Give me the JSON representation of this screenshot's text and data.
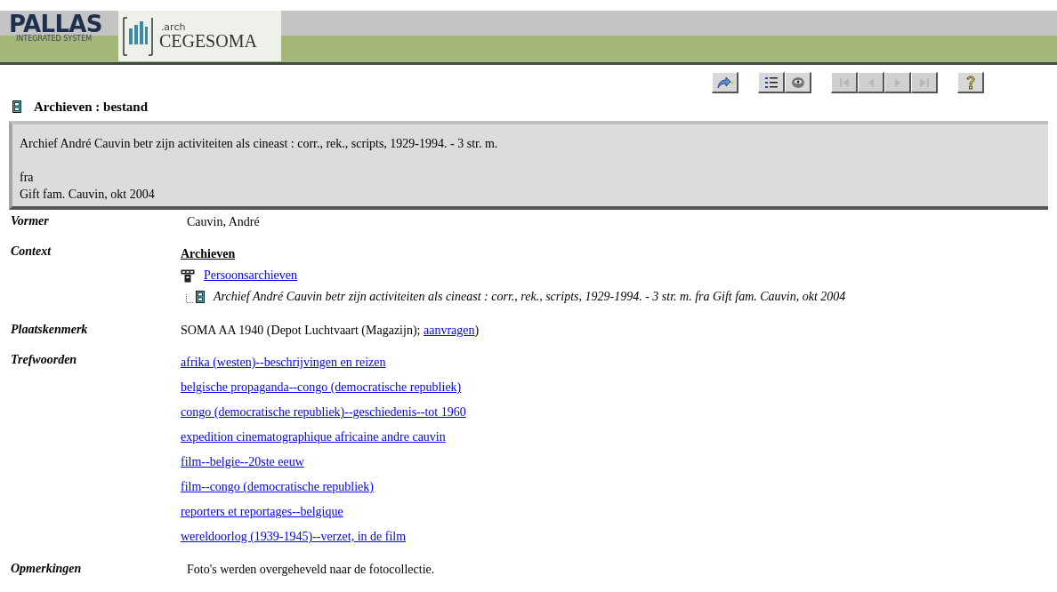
{
  "header": {
    "pallas_logo": {
      "title": "PALLAS",
      "subtitle": "INTEGRATED SYSTEM"
    },
    "cegesoma_logo": {
      "prefix": ".arch",
      "title": "CEGESOMA"
    }
  },
  "toolbar": [
    {
      "kind": "forward",
      "disabled": false
    },
    {
      "kind": "list",
      "disabled": false
    },
    {
      "kind": "view",
      "disabled": false
    },
    {
      "kind": "first",
      "disabled": true
    },
    {
      "kind": "prev",
      "disabled": true
    },
    {
      "kind": "next",
      "disabled": true
    },
    {
      "kind": "last",
      "disabled": true
    },
    {
      "kind": "help",
      "disabled": false
    }
  ],
  "page_title": "Archieven : bestand",
  "summary": {
    "description": "Archief André Cauvin betr zijn activiteiten als cineast : corr., rek., scripts, 1929-1994. - 3 str. m.",
    "language": "fra",
    "acquisition": "Gift fam. Cauvin, okt 2004"
  },
  "fields": [
    {
      "kind": "text",
      "label": "Vormer",
      "value": "Cauvin, André"
    },
    {
      "kind": "context",
      "label": "Context",
      "root": "Archieven",
      "parent": "Persoonsarchieven",
      "current": "Archief André Cauvin betr zijn activiteiten als cineast : corr., rek., scripts, 1929-1994. - 3 str. m. fra Gift fam. Cauvin, okt 2004"
    },
    {
      "kind": "location",
      "label": "Plaatskenmerk",
      "value": "SOMA AA 1940 (Depot Luchtvaart (Magazijn);",
      "link": "aanvragen",
      "after": ")"
    },
    {
      "kind": "keywords",
      "label": "Trefwoorden",
      "items": [
        "afrika (westen)--beschrijvingen en reizen",
        "belgische propaganda--congo (democratische republiek)",
        "congo (democratische republiek)--geschiedenis--tot 1960",
        "expedition cinematographique africaine andre cauvin",
        "film--belgie--20ste eeuw",
        "film--congo (democratische republiek)",
        "reporters et reportages--belgique",
        "wereldoorlog (1939-1945)--verzet, in de film"
      ]
    },
    {
      "kind": "text",
      "label": "Opmerkingen",
      "value": "Foto's werden overgeheveld naar de fotocollectie."
    }
  ]
}
